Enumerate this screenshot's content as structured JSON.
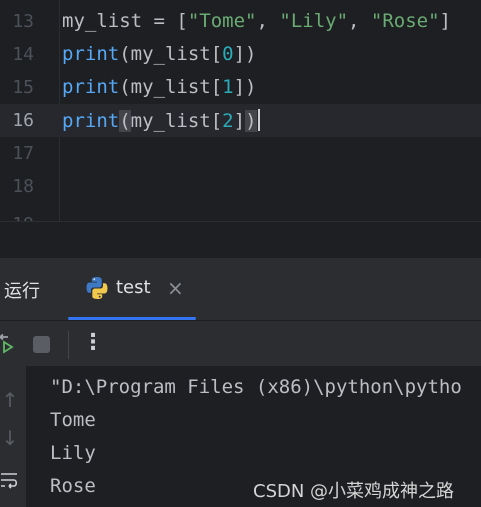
{
  "editor": {
    "lines": [
      {
        "number": "13",
        "tokens": [
          {
            "t": "my_list = [",
            "c": "plain"
          },
          {
            "t": "\"Tome\"",
            "c": "str"
          },
          {
            "t": ", ",
            "c": "plain"
          },
          {
            "t": "\"Lily\"",
            "c": "str"
          },
          {
            "t": ", ",
            "c": "plain"
          },
          {
            "t": "\"Rose\"",
            "c": "str"
          },
          {
            "t": "]",
            "c": "plain"
          }
        ]
      },
      {
        "number": "14",
        "tokens": [
          {
            "t": "print",
            "c": "fn"
          },
          {
            "t": "(my_list[",
            "c": "plain"
          },
          {
            "t": "0",
            "c": "num"
          },
          {
            "t": "])",
            "c": "plain"
          }
        ]
      },
      {
        "number": "15",
        "tokens": [
          {
            "t": "print",
            "c": "fn"
          },
          {
            "t": "(my_list[",
            "c": "plain"
          },
          {
            "t": "1",
            "c": "num"
          },
          {
            "t": "])",
            "c": "plain"
          }
        ]
      },
      {
        "number": "16",
        "tokens": [
          {
            "t": "print",
            "c": "fn"
          },
          {
            "t": "(",
            "c": "plain",
            "hl": true
          },
          {
            "t": "my_list[",
            "c": "plain"
          },
          {
            "t": "2",
            "c": "num"
          },
          {
            "t": "]",
            "c": "plain"
          },
          {
            "t": ")",
            "c": "plain",
            "hl": true
          }
        ],
        "current": true,
        "caret": true
      },
      {
        "number": "17",
        "tokens": []
      },
      {
        "number": "18",
        "tokens": []
      }
    ],
    "partial_line_number": "19"
  },
  "run_panel": {
    "title": "运行",
    "tab": {
      "label": "test",
      "icon": "python-icon",
      "close": "×"
    },
    "toolbar": {
      "rerun_icon": "rerun-icon",
      "stop_icon": "stop-icon",
      "more_label": "⋮"
    },
    "side": {
      "up": "↑",
      "down": "↓",
      "wrap_icon": "soft-wrap-icon"
    },
    "console_lines": [
      "\"D:\\Program Files (x86)\\python\\pytho",
      "Tome",
      "Lily",
      "Rose"
    ]
  },
  "watermark": "CSDN @小菜鸡成神之路",
  "colors": {
    "background": "#1e1f22",
    "function": "#56a8f5",
    "string": "#6aab73",
    "number": "#2aacb8",
    "accent": "#3574f0"
  }
}
